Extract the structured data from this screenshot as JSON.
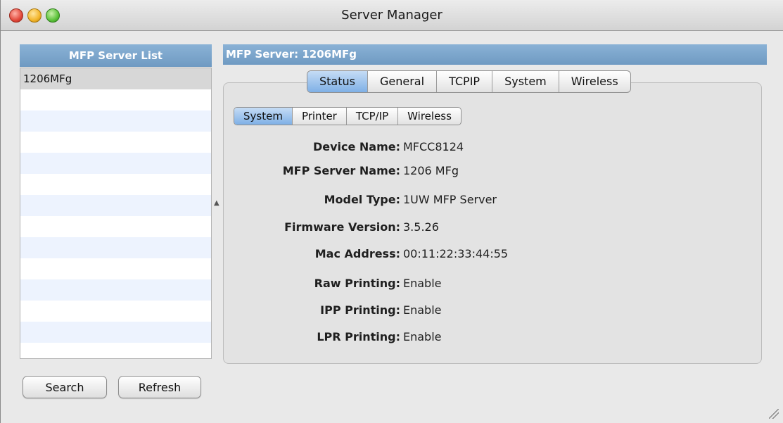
{
  "window": {
    "title": "Server Manager"
  },
  "server_list": {
    "header": "MFP Server List",
    "items": [
      "1206MFg"
    ],
    "selected_index": 0
  },
  "buttons": {
    "search": "Search",
    "refresh": "Refresh"
  },
  "server_panel": {
    "header": "MFP Server: 1206MFg",
    "tabs": [
      "Status",
      "General",
      "TCPIP",
      "System",
      "Wireless"
    ],
    "active_tab": "Status",
    "sub_tabs": [
      "System",
      "Printer",
      "TCP/IP",
      "Wireless"
    ],
    "active_sub_tab": "System",
    "fields": [
      {
        "label": "Device Name:",
        "value": "MFCC8124"
      },
      {
        "label": "MFP Server Name:",
        "value": "1206 MFg"
      },
      {
        "label": "Model Type:",
        "value": "1UW MFP Server"
      },
      {
        "label": "Firmware Version:",
        "value": "3.5.26"
      },
      {
        "label": "Mac Address:",
        "value": "00:11:22:33:44:55"
      },
      {
        "label": "Raw Printing:",
        "value": "Enable"
      },
      {
        "label": "IPP Printing:",
        "value": "Enable"
      },
      {
        "label": "LPR Printing:",
        "value": "Enable"
      }
    ]
  },
  "colors": {
    "header_blue": "#7ea6cd",
    "active_tab": "#9fc4ee",
    "list_alt_row": "#edf3fe",
    "selected_row": "#d7d7d7"
  }
}
